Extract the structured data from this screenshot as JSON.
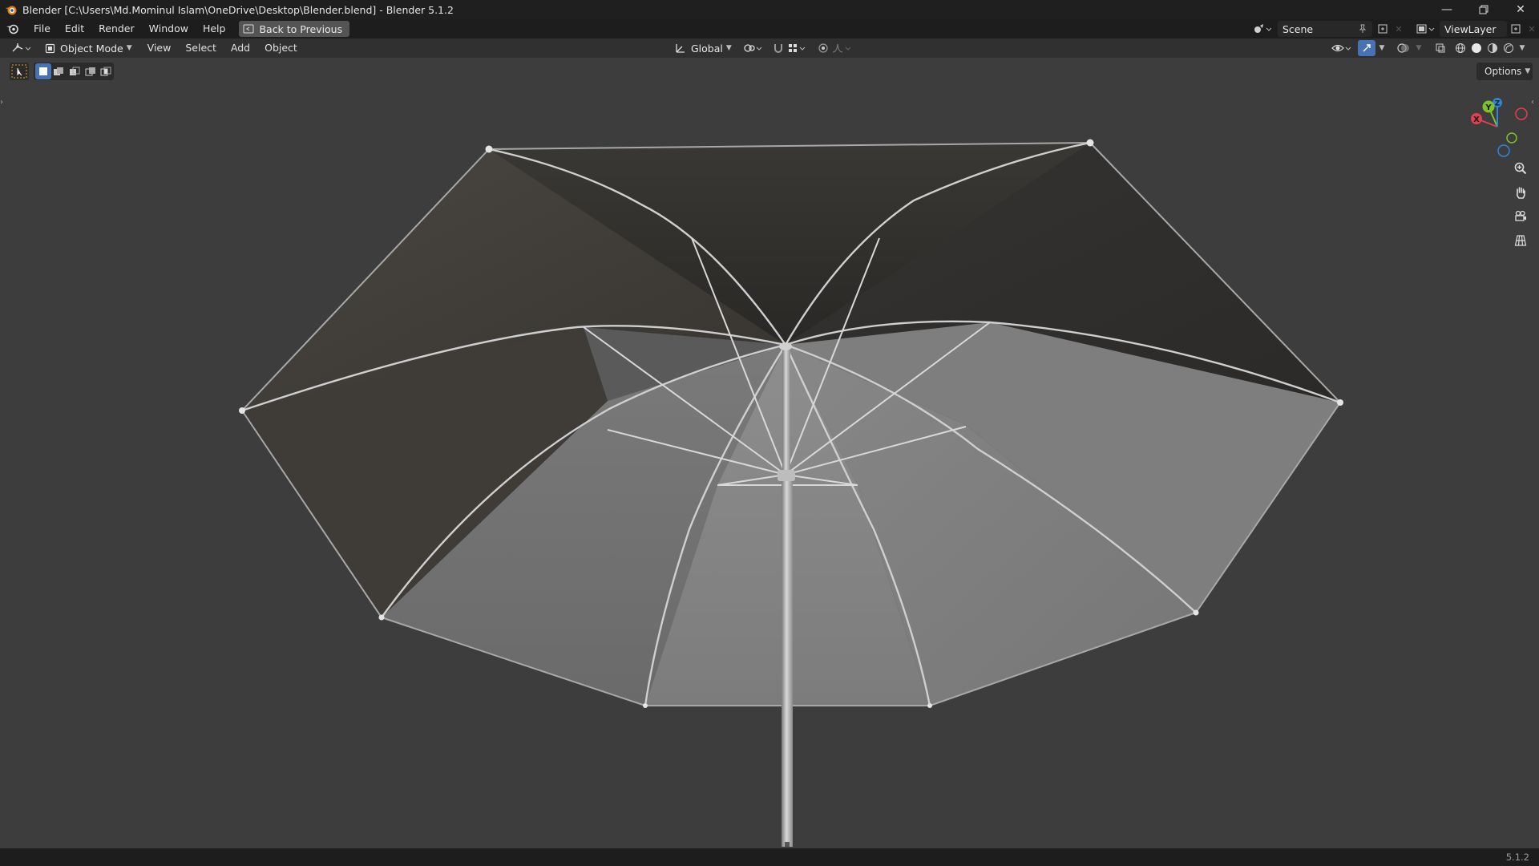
{
  "window": {
    "title": "Blender [C:\\Users\\Md.Mominul Islam\\OneDrive\\Desktop\\Blender.blend] - Blender 5.1.2",
    "controls": [
      "minimize",
      "maximize",
      "close"
    ]
  },
  "menubar": {
    "items": [
      "File",
      "Edit",
      "Render",
      "Window",
      "Help"
    ],
    "back_button": "Back to Previous",
    "scene_name": "Scene",
    "view_layer": "ViewLayer"
  },
  "viewport_header": {
    "mode": "Object Mode",
    "items": [
      "View",
      "Select",
      "Add",
      "Object"
    ],
    "transform_orientation": "Global"
  },
  "tool_settings": {
    "options_label": "Options"
  },
  "navigation_gizmo": {
    "axes": {
      "x": "X",
      "y": "Y",
      "z": "Z"
    },
    "colors": {
      "x": "#e0404f",
      "y": "#7fc229",
      "z": "#2f86d9"
    }
  },
  "status_bar": {
    "version": "5.1.2"
  },
  "colors": {
    "background": "#3d3d3d",
    "titlebar": "#1f1f1f",
    "menubar": "#1d1d1d",
    "header": "#303030",
    "accent": "#4772b3"
  }
}
